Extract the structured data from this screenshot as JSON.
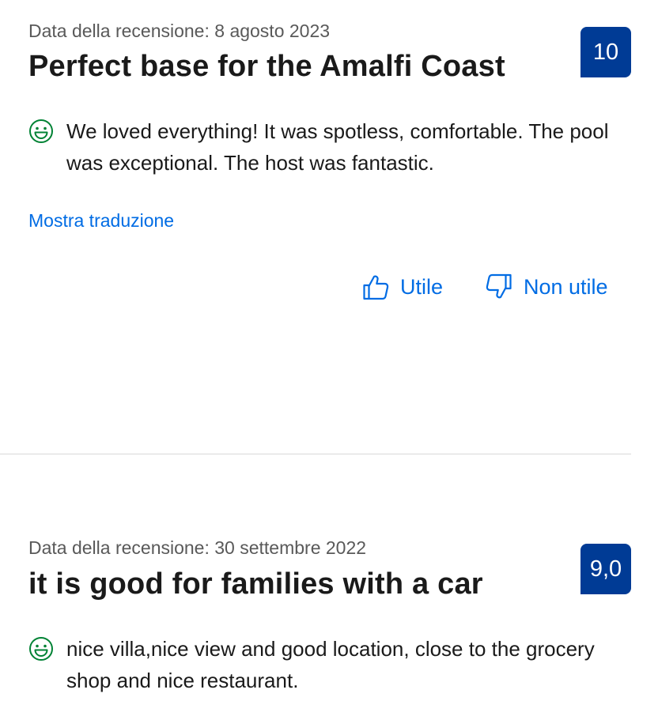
{
  "reviews": [
    {
      "date_text": "Data della recensione: 8 agosto 2023",
      "title": "Perfect base for the Amalfi Coast",
      "score": "10",
      "positive_text": "We loved everything! It was spotless, comfortable. The pool was exceptional. The host was fantastic.",
      "translate_label": "Mostra traduzione",
      "helpful_label": "Utile",
      "not_helpful_label": "Non utile"
    },
    {
      "date_text": "Data della recensione: 30 settembre 2022",
      "title": "it is good for families with a car",
      "score": "9,0",
      "positive_text": "nice villa,nice view and good location, close to the grocery shop and nice restaurant."
    }
  ],
  "colors": {
    "score_badge": "#003b95",
    "link": "#006ce4",
    "positive_icon": "#008234",
    "divider": "#d9d9d9"
  },
  "icons": {
    "positive": "smiley-face-icon",
    "helpful": "thumbs-up-icon",
    "not_helpful": "thumbs-down-icon"
  }
}
